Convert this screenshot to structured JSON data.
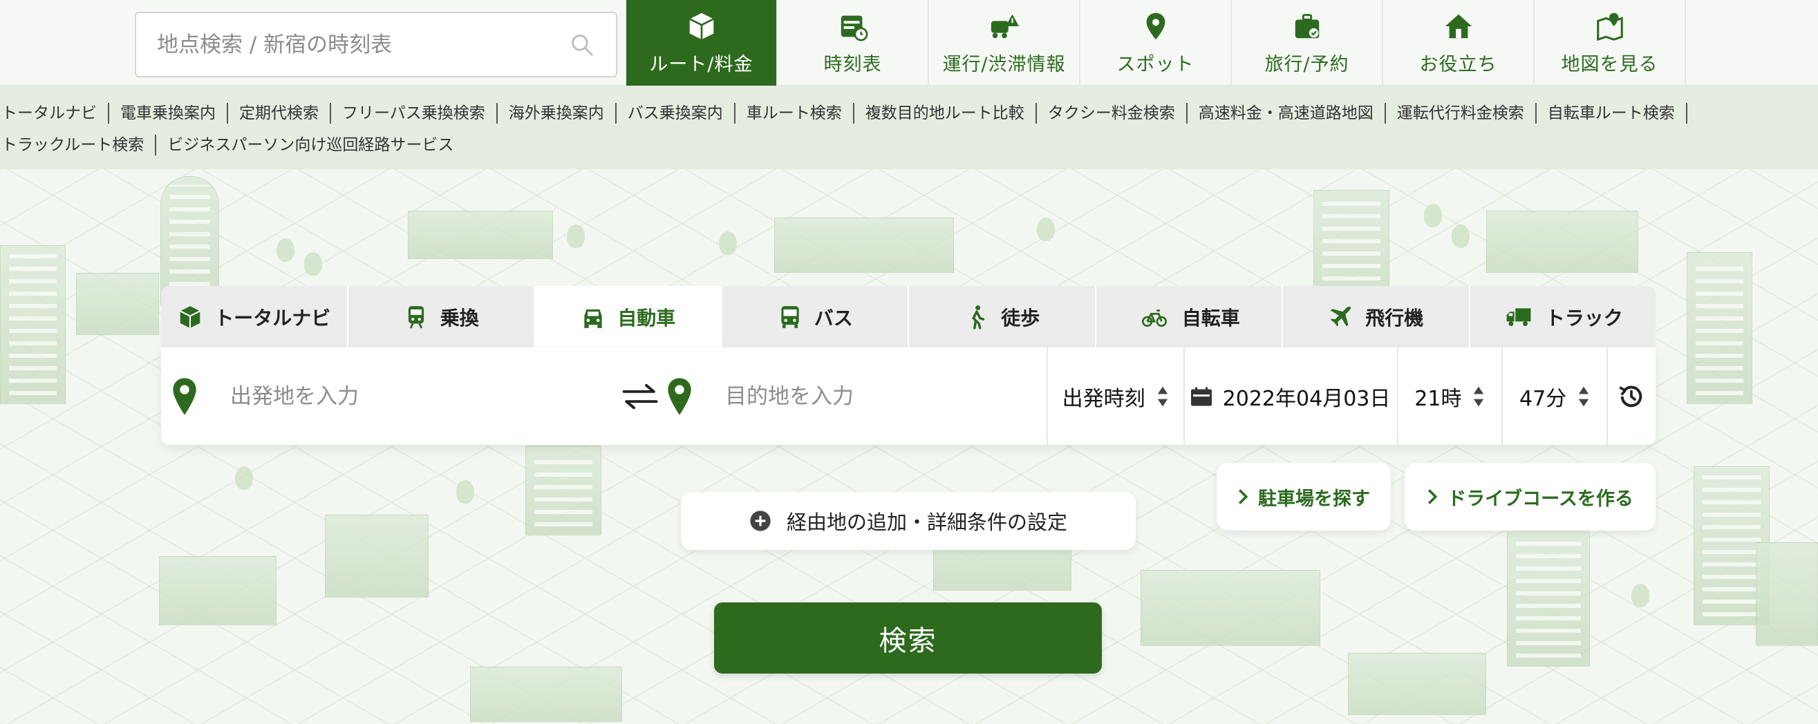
{
  "header": {
    "search_placeholder": "地点検索 / 新宿の時刻表",
    "nav": [
      {
        "label": "ルート/料金",
        "icon": "route-box-icon",
        "active": true
      },
      {
        "label": "時刻表",
        "icon": "timetable-icon"
      },
      {
        "label": "運行/渋滞情報",
        "icon": "traffic-alert-icon"
      },
      {
        "label": "スポット",
        "icon": "map-pin-icon"
      },
      {
        "label": "旅行/予約",
        "icon": "suitcase-icon"
      },
      {
        "label": "お役立ち",
        "icon": "house-icon"
      },
      {
        "label": "地図を見る",
        "icon": "map-icon"
      }
    ]
  },
  "subnav": {
    "row1": [
      "トータルナビ",
      "電車乗換案内",
      "定期代検索",
      "フリーパス乗換検索",
      "海外乗換案内",
      "バス乗換案内",
      "車ルート検索",
      "複数目的地ルート比較",
      "タクシー料金検索",
      "高速料金・高速道路地図",
      "運転代行料金検索",
      "自転車ルート検索"
    ],
    "row2": [
      "トラックルート検索",
      "ビジネスパーソン向け巡回経路サービス"
    ]
  },
  "modes": [
    {
      "label": "トータルナビ",
      "icon": "total-navi-icon"
    },
    {
      "label": "乗換",
      "icon": "train-icon"
    },
    {
      "label": "自動車",
      "icon": "car-icon",
      "active": true
    },
    {
      "label": "バス",
      "icon": "bus-icon"
    },
    {
      "label": "徒歩",
      "icon": "walk-icon"
    },
    {
      "label": "自転車",
      "icon": "bicycle-icon"
    },
    {
      "label": "飛行機",
      "icon": "airplane-icon"
    },
    {
      "label": "トラック",
      "icon": "truck-icon"
    }
  ],
  "route": {
    "from_placeholder": "出発地を入力",
    "to_placeholder": "目的地を入力",
    "time_type": "出発時刻",
    "date": "2022年04月03日",
    "hour": "21時",
    "minute": "47分"
  },
  "actions": {
    "waypoint": "経由地の追加・詳細条件の設定",
    "parking": "駐車場を探す",
    "drive_course": "ドライブコースを作る",
    "search": "検索"
  },
  "colors": {
    "brand_green": "#2e6a1e",
    "text_green": "#2c6b1f",
    "subnav_bg": "#e4eddf"
  }
}
